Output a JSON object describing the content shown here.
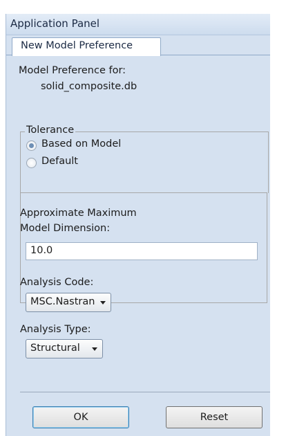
{
  "panel": {
    "title": "Application Panel",
    "tab_label": "New Model Preference"
  },
  "model": {
    "preference_label": "Model Preference for:",
    "filename": "solid_composite.db"
  },
  "tolerance": {
    "group_label": "Tolerance",
    "options": [
      "Based on Model",
      "Default"
    ],
    "selected": "Based on Model"
  },
  "dimension": {
    "label_line1": "Approximate Maximum",
    "label_line2": "Model Dimension:",
    "value": "10.0"
  },
  "analysis_code": {
    "label": "Analysis Code:",
    "selected": "MSC.Nastran"
  },
  "analysis_type": {
    "label": "Analysis Type:",
    "selected": "Structural"
  },
  "buttons": {
    "ok": "OK",
    "reset": "Reset"
  }
}
